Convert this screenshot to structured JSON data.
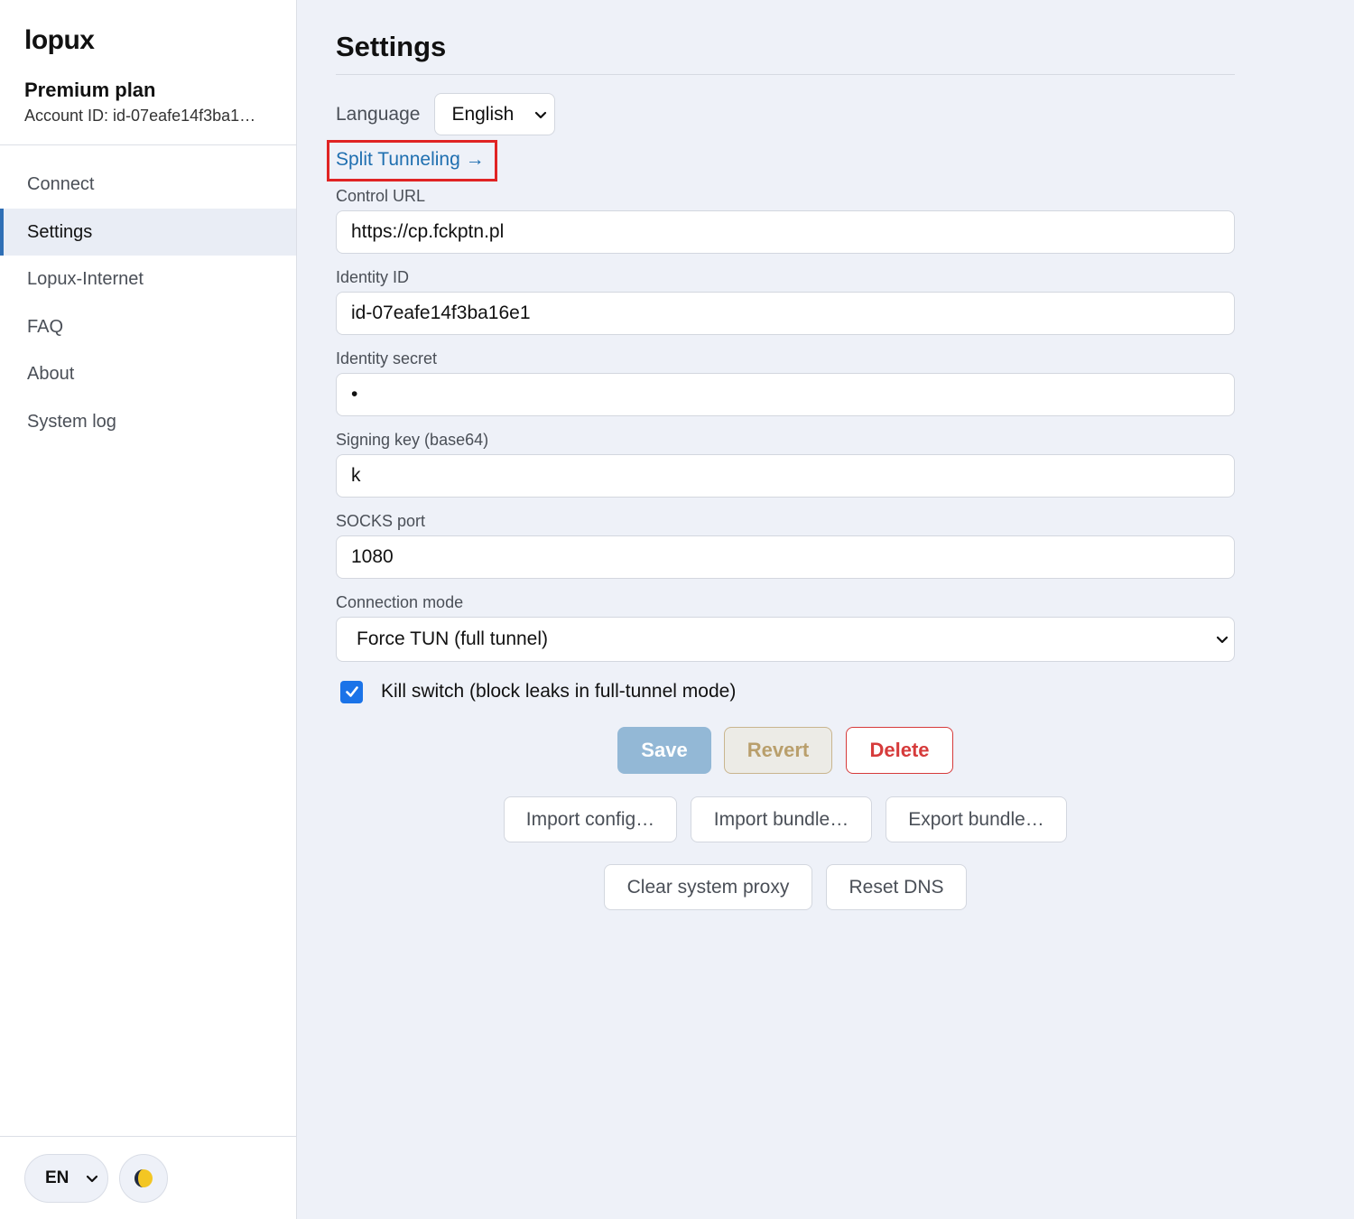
{
  "app": {
    "name": "lopux"
  },
  "account": {
    "plan": "Premium plan",
    "id_line": "Account ID: id-07eafe14f3ba1…"
  },
  "nav": {
    "items": [
      {
        "label": "Connect",
        "active": false
      },
      {
        "label": "Settings",
        "active": true
      },
      {
        "label": "Lopux-Internet",
        "active": false
      },
      {
        "label": "FAQ",
        "active": false
      },
      {
        "label": "About",
        "active": false
      },
      {
        "label": "System log",
        "active": false
      }
    ]
  },
  "footer": {
    "language_code": "EN",
    "theme_icon": "half-moon-icon"
  },
  "page": {
    "title": "Settings"
  },
  "settings": {
    "language_label": "Language",
    "language_value": "English",
    "split_tunneling_link": "Split Tunneling →",
    "control_url_label": "Control URL",
    "control_url_value": "https://cp.fckptn.pl",
    "identity_id_label": "Identity ID",
    "identity_id_value": "id-07eafe14f3ba16e1",
    "identity_secret_label": "Identity secret",
    "identity_secret_value": "•",
    "signing_key_label": "Signing key (base64)",
    "signing_key_value": "k",
    "socks_port_label": "SOCKS port",
    "socks_port_value": "1080",
    "connection_mode_label": "Connection mode",
    "connection_mode_value": "Force TUN (full tunnel)",
    "kill_switch_label": "Kill switch (block leaks in full-tunnel mode)",
    "kill_switch_checked": true
  },
  "actions": {
    "save": "Save",
    "revert": "Revert",
    "delete": "Delete",
    "import_config": "Import config…",
    "import_bundle": "Import bundle…",
    "export_bundle": "Export bundle…",
    "clear_proxy": "Clear system proxy",
    "reset_dns": "Reset DNS"
  },
  "colors": {
    "accent": "#1a73e8",
    "link": "#1f6fb0",
    "danger": "#d63b3b",
    "highlight_box": "#e02424"
  }
}
